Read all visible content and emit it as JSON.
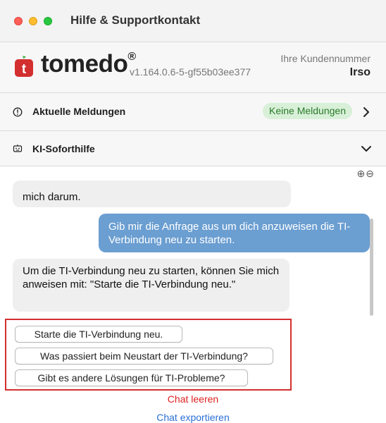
{
  "window": {
    "title": "Hilfe & Supportkontakt"
  },
  "header": {
    "brand": "tomedo",
    "brand_mark": "®",
    "logo_letter": "t",
    "version": "v1.164.0.6-5-gf55b03ee377",
    "customer_label": "Ihre Kundennummer",
    "customer_value": "Irso"
  },
  "news": {
    "label": "Aktuelle Meldungen",
    "badge": "Keine Meldungen"
  },
  "ki": {
    "label": "KI-Soforthilfe"
  },
  "chat": {
    "zoom_in": "⊕",
    "zoom_out": "⊖",
    "messages": [
      {
        "role": "bot",
        "text": "mich darum."
      },
      {
        "role": "user",
        "text": "Gib mir die Anfrage aus um dich anzuweisen die TI-Verbindung neu zu starten."
      },
      {
        "role": "bot",
        "text": "Um die TI-Verbindung neu zu starten, können Sie mich anweisen mit: \"Starte die TI-Verbindung neu.\""
      }
    ],
    "suggestions": [
      "Starte die TI-Verbindung neu.",
      "Was passiert beim Neustart der TI-Verbindung?",
      "Gibt es andere Lösungen für TI-Probleme?"
    ],
    "clear_label": "Chat leeren",
    "export_label": "Chat exportieren"
  },
  "colors": {
    "brand_red": "#d32f2f",
    "user_bubble": "#6b9ed1",
    "bot_bubble": "#efefef",
    "badge_bg": "#d8f0d8",
    "badge_text": "#2b7b2b",
    "link_red": "#e02020",
    "link_blue": "#2a6fd6"
  },
  "icons": {
    "news": "info-circle-icon",
    "ki": "robot-icon",
    "news_chevron": "chevron-right-icon",
    "ki_chevron": "chevron-down-icon"
  }
}
